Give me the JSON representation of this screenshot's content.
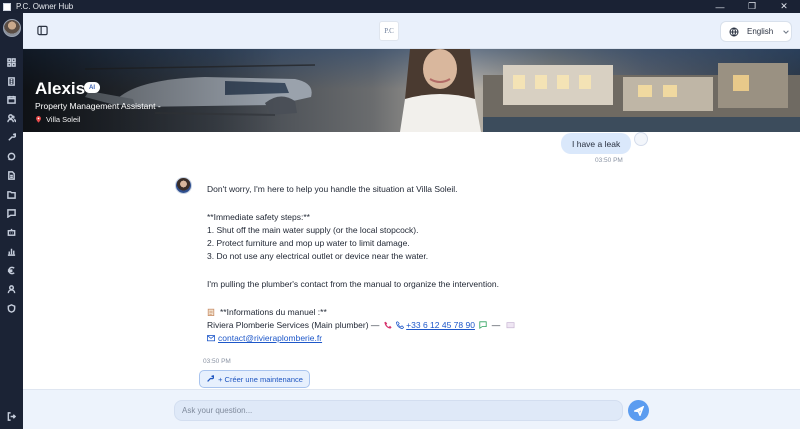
{
  "window": {
    "title": "P.C. Owner Hub",
    "controls": {
      "minimize": "—",
      "maximize": "❐",
      "close": "✕"
    }
  },
  "sidebar": {
    "items": [
      {
        "icon": "dashboard-icon"
      },
      {
        "icon": "building-icon"
      },
      {
        "icon": "calendar-icon"
      },
      {
        "icon": "users-icon"
      },
      {
        "icon": "wrench-icon"
      },
      {
        "icon": "chat-icon"
      },
      {
        "icon": "document-icon"
      },
      {
        "icon": "folder-icon"
      },
      {
        "icon": "message-icon"
      },
      {
        "icon": "robot-icon"
      },
      {
        "icon": "chart-icon"
      },
      {
        "icon": "euro-icon"
      },
      {
        "icon": "person-icon"
      },
      {
        "icon": "shield-icon"
      }
    ],
    "logout_icon": "logout-icon"
  },
  "header": {
    "logo_text": "P.C",
    "language": "English"
  },
  "hero": {
    "name": "Alexis",
    "badge": "AI",
    "role": "Property Management Assistant -",
    "location": "Villa Soleil"
  },
  "chat": {
    "user_message": "I have a leak",
    "user_time": "03:50 PM",
    "bot": {
      "line1": "Don't worry, I'm here to help you handle the situation at Villa Soleil.",
      "line2": "**Immediate safety steps:**",
      "line3": "1. Shut off the main water supply (or the local stopcock).",
      "line4": "2. Protect furniture and mop up water to limit damage.",
      "line5": "3. Do not use any electrical outlet or device near the water.",
      "line6": "I'm pulling the plumber's contact from the manual to organize the intervention.",
      "line7": "**Informations du manuel :**",
      "contact_prefix": "Riviera Plomberie Services (Main plumber) —",
      "phone": "+33 6 12 45 78 90",
      "separator": "—",
      "email": "contact@rivieraplomberie.fr"
    },
    "bot_time": "03:50 PM",
    "maintenance_button": "+ Créer une maintenance"
  },
  "composer": {
    "placeholder": "Ask your question..."
  }
}
